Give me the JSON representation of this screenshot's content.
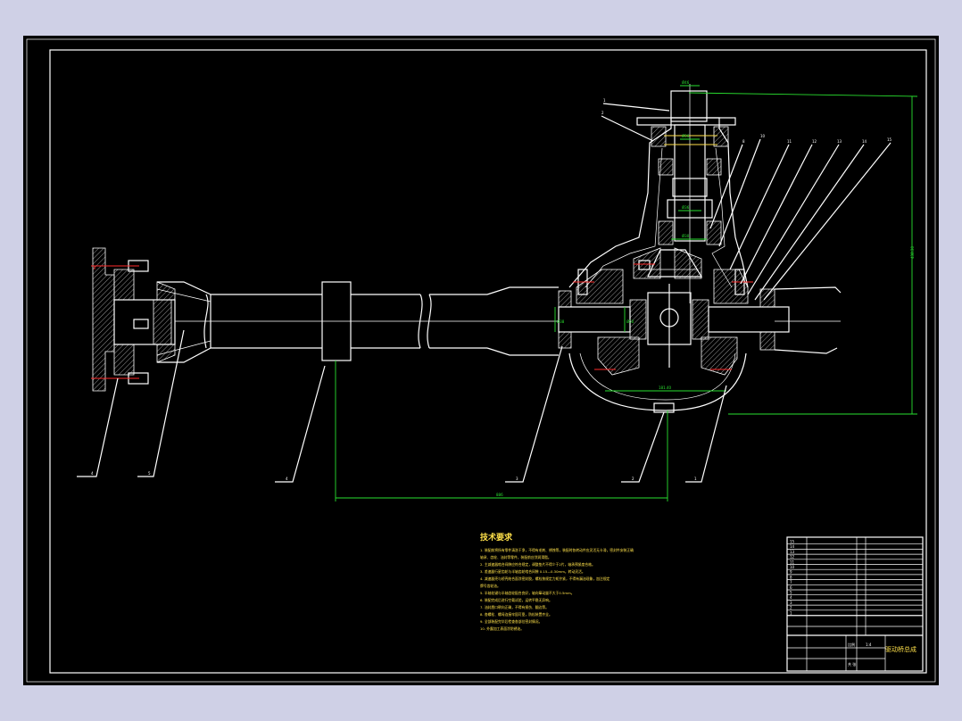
{
  "drawing": {
    "dimensions": {
      "horizontal": "886",
      "vertical": "438.30",
      "diameters": [
        "Ø38",
        "Ø50",
        "Ø46",
        "Ø36",
        "Ø30",
        "Ø56"
      ],
      "center_width": "181.40"
    },
    "balloons": {
      "top": [
        "1",
        "2",
        "8",
        "10",
        "11",
        "12",
        "13",
        "14",
        "15"
      ],
      "bottom": [
        "4",
        "5",
        "4",
        "3",
        "2",
        "1"
      ]
    }
  },
  "notes": {
    "title": "技术要求",
    "lines": [
      "1. 装配前将所有零件清洗干净，不得有毛刺、锈蚀等，装配时各转动件应灵活无卡滞，密封件安装正确",
      "   轴承、齿轮、油封等零件，装配前应涂润滑脂。",
      "2. 主减速器啮合间隙应符合规定，调整垫片不得少于2片，轴承预紧度合格。",
      "3. 差速器行星齿轮与半轴齿轮啮合间隙 0.15—0.30mm，转动灵活。",
      "4. 减速器壳与桥壳结合面涂密封胶，螺栓按规定力矩拧紧，不得有漏油现象，加注规定",
      "   牌号齿轮油。",
      "5. 半轴花键与半轴齿轮配合良好，轴向窜动量不大于0.5mm。",
      "6. 装配完成后进行空载试验，运转平稳无异响。",
      "7. 油封唇口朝向正确，不得有损伤、翻边等。",
      "8. 各螺栓、螺母连接牢固可靠，防松装置齐全。",
      "9. 全部装配完毕后检查各部位密封情况。",
      "10. 外露加工表面涂防锈油。"
    ]
  },
  "title_block": {
    "title": "驱动桥总成",
    "parts_rows": [
      [
        "15",
        "",
        "",
        ""
      ],
      [
        "14",
        "",
        "",
        ""
      ],
      [
        "13",
        "",
        "",
        ""
      ],
      [
        "12",
        "",
        "",
        ""
      ],
      [
        "11",
        "",
        "",
        ""
      ],
      [
        "10",
        "",
        "",
        ""
      ],
      [
        "9",
        "",
        "",
        ""
      ],
      [
        "8",
        "",
        "",
        ""
      ],
      [
        "7",
        "",
        "",
        ""
      ],
      [
        "6",
        "",
        "",
        ""
      ],
      [
        "5",
        "",
        "",
        ""
      ],
      [
        "4",
        "",
        "",
        ""
      ],
      [
        "3",
        "",
        "",
        ""
      ],
      [
        "2",
        "",
        "",
        ""
      ],
      [
        "1",
        "",
        "",
        ""
      ]
    ],
    "scale_label": "比例",
    "scale_value": "1:4",
    "sheet_label": "共 张"
  }
}
